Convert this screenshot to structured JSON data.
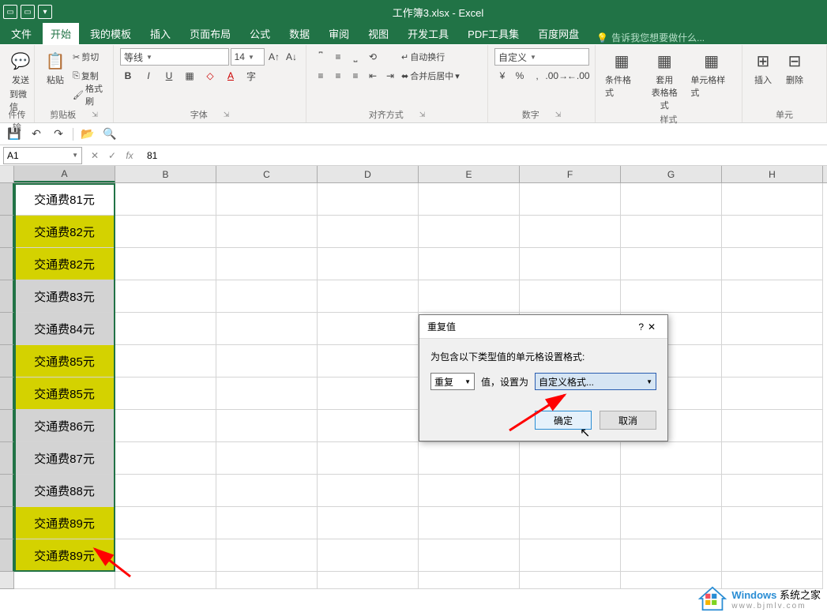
{
  "title": "工作簿3.xlsx - Excel",
  "tabs": [
    "文件",
    "开始",
    "我的模板",
    "插入",
    "页面布局",
    "公式",
    "数据",
    "审阅",
    "视图",
    "开发工具",
    "PDF工具集",
    "百度网盘"
  ],
  "tell_me": "告诉我您想要做什么...",
  "ribbon": {
    "wechat": {
      "label1": "发送",
      "label2": "到微信",
      "group": "件传输"
    },
    "clipboard": {
      "paste": "粘贴",
      "cut": "剪切",
      "copy": "复制",
      "format": "格式刷",
      "group": "剪贴板"
    },
    "font": {
      "name": "等线",
      "size": "14",
      "group": "字体"
    },
    "align": {
      "wrap": "自动换行",
      "merge": "合并后居中",
      "group": "对齐方式"
    },
    "number": {
      "format": "自定义",
      "group": "数字"
    },
    "style": {
      "cond": "条件格式",
      "table": "套用\n表格格式",
      "cell": "单元格样式",
      "group": "样式"
    },
    "cells": {
      "insert": "插入",
      "delete": "删除",
      "group": "单元"
    }
  },
  "name_box": "A1",
  "formula": "81",
  "columns": [
    "A",
    "B",
    "C",
    "D",
    "E",
    "F",
    "G",
    "H"
  ],
  "cells": [
    {
      "v": "交通费81元",
      "hl": false,
      "first": true
    },
    {
      "v": "交通费82元",
      "hl": true
    },
    {
      "v": "交通费82元",
      "hl": true
    },
    {
      "v": "交通费83元",
      "hl": false
    },
    {
      "v": "交通费84元",
      "hl": false
    },
    {
      "v": "交通费85元",
      "hl": true
    },
    {
      "v": "交通费85元",
      "hl": true
    },
    {
      "v": "交通费86元",
      "hl": false
    },
    {
      "v": "交通费87元",
      "hl": false
    },
    {
      "v": "交通费88元",
      "hl": false
    },
    {
      "v": "交通费89元",
      "hl": true
    },
    {
      "v": "交通费89元",
      "hl": true
    }
  ],
  "dialog": {
    "title": "重复值",
    "help": "?",
    "desc": "为包含以下类型值的单元格设置格式:",
    "type": "重复",
    "label": "值，设置为",
    "format": "自定义格式...",
    "ok": "确定",
    "cancel": "取消"
  },
  "watermark": {
    "brand": "Windows",
    "suffix": "系统之家",
    "url": "www.bjmlv.com"
  }
}
